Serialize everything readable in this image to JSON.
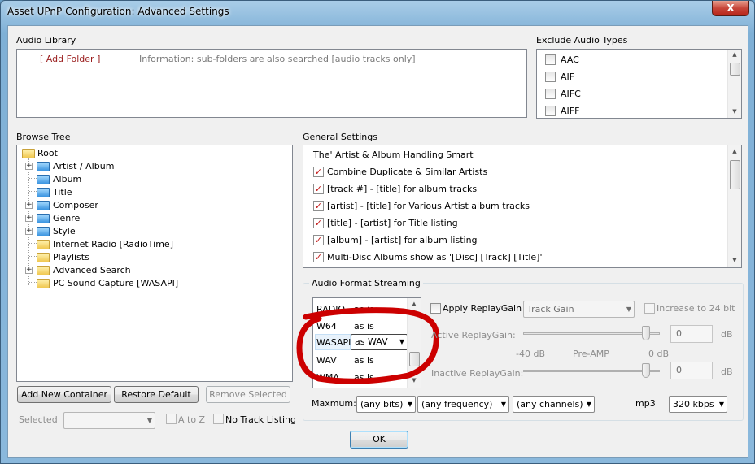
{
  "window": {
    "title": "Asset UPnP Configuration: Advanced Settings",
    "close_glyph": "X"
  },
  "audio_library": {
    "label": "Audio Library",
    "add_folder": "[ Add Folder ]",
    "info": "Information: sub-folders are also searched [audio tracks only]"
  },
  "exclude": {
    "label": "Exclude Audio Types",
    "items": [
      "AAC",
      "AIF",
      "AIFC",
      "AIFF"
    ]
  },
  "browse_tree": {
    "label": "Browse Tree",
    "root": "Root",
    "items": [
      "Artist / Album",
      "Album",
      "Title",
      "Composer",
      "Genre",
      "Style",
      "Internet Radio [RadioTime]",
      "Playlists",
      "Advanced Search",
      "PC Sound Capture [WASAPI]"
    ]
  },
  "general": {
    "label": "General Settings",
    "first": "'The' Artist & Album Handling Smart",
    "items": [
      "Combine Duplicate & Similar Artists",
      "[track #] - [title] for album tracks",
      "[artist] - [title] for Various Artist album tracks",
      "[title] - [artist] for Title listing",
      "[album] - [artist] for album listing",
      "Multi-Disc Albums show as '[Disc] [Track] [Title]'"
    ]
  },
  "streaming": {
    "label": "Audio Format Streaming",
    "formats": [
      {
        "name": "RADIO",
        "mode": "as is"
      },
      {
        "name": "W64",
        "mode": "as is"
      },
      {
        "name": "WASAPI",
        "mode": "as WAV"
      },
      {
        "name": "WAV",
        "mode": "as is"
      },
      {
        "name": "WMA",
        "mode": "as is"
      }
    ],
    "apply_rg": "Apply ReplayGain",
    "rg_mode": "Track Gain",
    "increase": "Increase to 24 bit",
    "active_rg": "Active ReplayGain:",
    "inactive_rg": "Inactive ReplayGain:",
    "val1": "0",
    "val2": "0",
    "db": "dB",
    "neg40": "-40 dB",
    "preamp": "Pre-AMP",
    "zero": "0 dB",
    "active_level": 0.9,
    "inactive_level": 0.9,
    "maximum": "Maxmum:",
    "bits": "(any bits)",
    "freq": "(any frequency)",
    "channels": "(any channels)",
    "mp3": "mp3",
    "kbps": "320 kbps"
  },
  "buttons": {
    "add": "Add New Container",
    "restore": "Restore Default",
    "remove": "Remove Selected",
    "ok": "OK"
  },
  "bottom": {
    "selected": "Selected",
    "atoz": "A to Z",
    "notrack": "No Track Listing"
  },
  "colors": {
    "annotation": "#cc0000",
    "check": "#c21818",
    "add_folder": "#9a1c1c"
  }
}
